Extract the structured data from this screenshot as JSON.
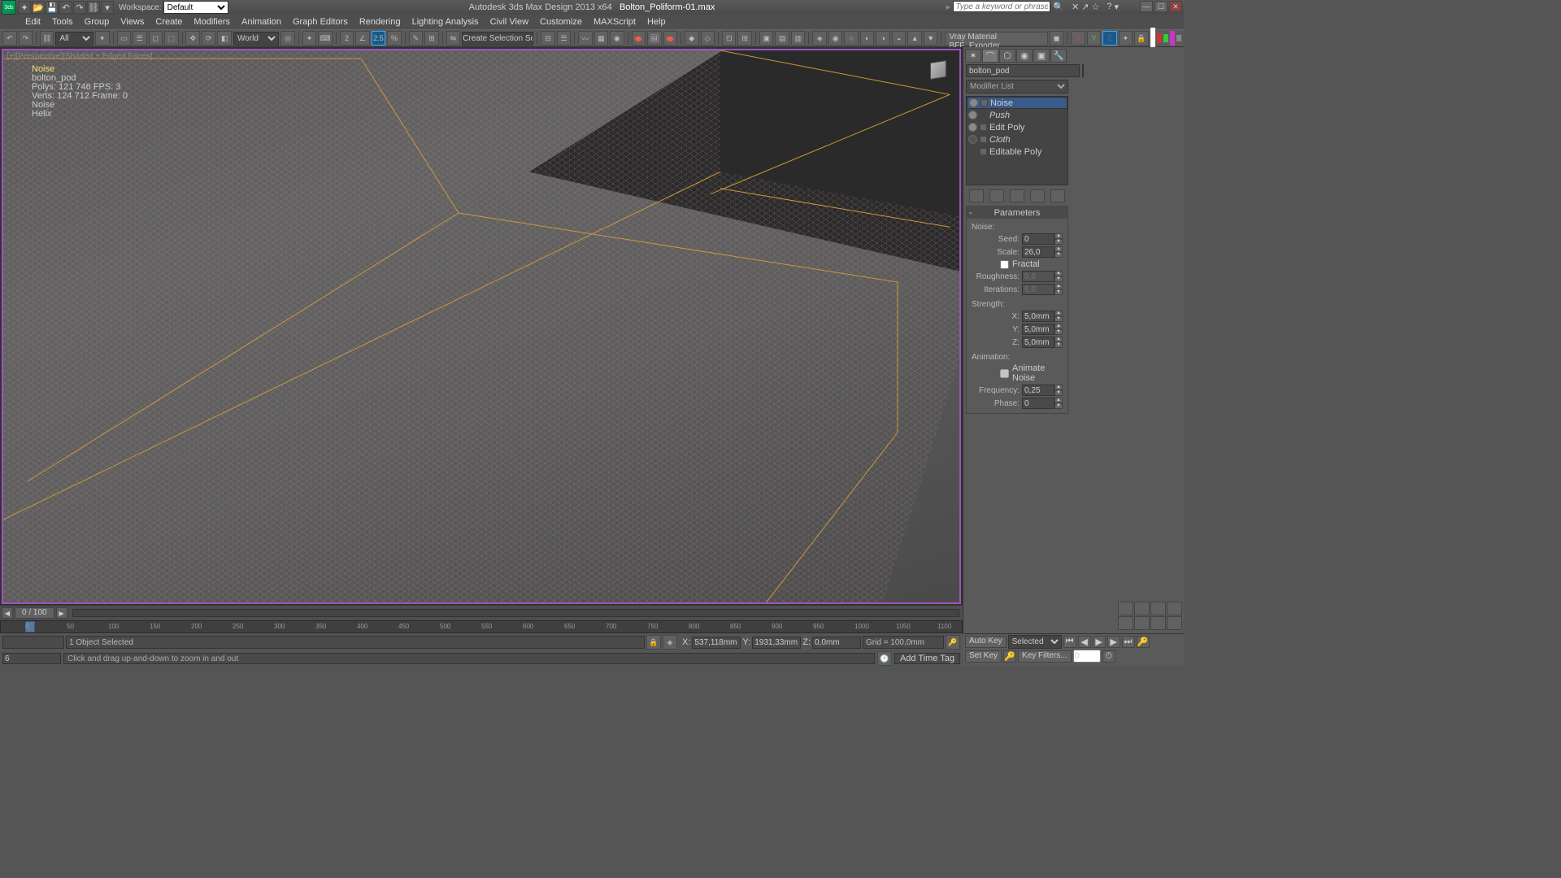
{
  "title": {
    "app": "Autodesk 3ds Max Design 2013 x64",
    "file": "Bolton_Poliform-01.max",
    "workspace_label": "Workspace:",
    "workspace_value": "Default"
  },
  "search": {
    "placeholder": "Type a keyword or phrase"
  },
  "menus": [
    "Edit",
    "Tools",
    "Group",
    "Views",
    "Create",
    "Modifiers",
    "Animation",
    "Graph Editors",
    "Rendering",
    "Lighting Analysis",
    "Civil View",
    "Customize",
    "MAXScript",
    "Help"
  ],
  "toolbar": {
    "filter_sel": "All",
    "coord_sel": "World",
    "selset": "Create Selection Se",
    "vray_btn": "Vray Material  BFF_Exporter"
  },
  "viewport": {
    "label": "[+][Perspective][Shaded + Edged Faces]",
    "stats": [
      "Noise",
      "bolton_pod",
      "Polys: 121 746   FPS: 3",
      "Verts: 124 712   Frame: 0",
      "Noise",
      "",
      "Helix"
    ],
    "frame": "0 / 100"
  },
  "panel": {
    "obj_name": "bolton_pod",
    "modlist": "Modifier List",
    "stack": [
      {
        "name": "Noise",
        "eye": true,
        "sq": true,
        "sel": true,
        "it": false
      },
      {
        "name": "Push",
        "eye": true,
        "sq": false,
        "sel": false,
        "it": true
      },
      {
        "name": "Edit Poly",
        "eye": true,
        "sq": true,
        "sel": false,
        "it": false
      },
      {
        "name": "Cloth",
        "eye": false,
        "sq": true,
        "sel": false,
        "it": true
      },
      {
        "name": "Editable Poly",
        "eye": null,
        "sq": true,
        "sel": false,
        "it": false
      }
    ],
    "rollout": "Parameters",
    "noise": {
      "section": "Noise:",
      "seed_lbl": "Seed:",
      "seed": "0",
      "scale_lbl": "Scale:",
      "scale": "26,0",
      "fractal": "Fractal",
      "rough_lbl": "Roughness:",
      "rough": "0,0",
      "iter_lbl": "Iterations:",
      "iter": "6,0"
    },
    "strength": {
      "section": "Strength:",
      "x_lbl": "X:",
      "x": "5,0mm",
      "y_lbl": "Y:",
      "y": "5,0mm",
      "z_lbl": "Z:",
      "z": "5,0mm"
    },
    "anim": {
      "section": "Animation:",
      "animate": "Animate Noise",
      "freq_lbl": "Frequency:",
      "freq": "0,25",
      "phase_lbl": "Phase:",
      "phase": "0"
    }
  },
  "status": {
    "selected": "1 Object Selected",
    "x_lbl": "X:",
    "x": "537,118mm",
    "y_lbl": "Y:",
    "y": "1931,33mm",
    "z_lbl": "Z:",
    "z": "0,0mm",
    "grid": "Grid = 100,0mm",
    "addtag": "Add Time Tag",
    "prompt_val": "6",
    "prompt_msg": "Click and drag up-and-down to zoom in and out"
  },
  "animctrl": {
    "autokey": "Auto Key",
    "selected": "Selected",
    "setkey": "Set Key",
    "filters": "Key Filters...",
    "frame": "0"
  },
  "track_marks": [
    "0",
    "50",
    "100",
    "150",
    "200",
    "250",
    "300",
    "350",
    "400",
    "450",
    "500",
    "550",
    "600",
    "650",
    "700",
    "750",
    "800",
    "850",
    "900",
    "950",
    "1000",
    "1050",
    "1100"
  ]
}
